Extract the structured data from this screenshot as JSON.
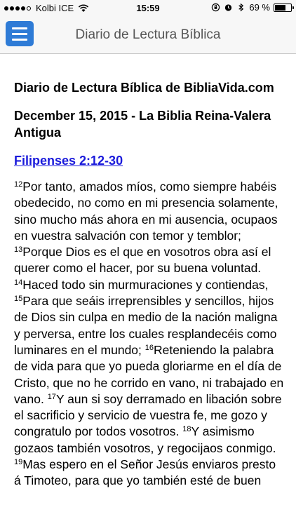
{
  "status_bar": {
    "carrier": "Kolbi ICE",
    "time": "15:59",
    "battery_percent": "69 %",
    "battery_level": 0.69,
    "icons": [
      "wifi-icon",
      "orientation-lock-icon",
      "alarm-icon",
      "bluetooth-icon"
    ]
  },
  "nav": {
    "title": "Diario de Lectura Bíblica",
    "menu_icon": "hamburger-menu-icon",
    "accent_color": "#2e7bd6"
  },
  "content": {
    "site_heading": "Diario de Lectura Bíblica de BibliaVida.com",
    "date_heading": "December 15, 2015 - La Biblia Reina-Valera Antigua",
    "passage_ref": "Filipenses 2:12-30",
    "link_color": "#1a1adb",
    "verses": [
      {
        "num": "12",
        "text": "Por tanto, amados míos, como siempre habéis obedecido, no como en mi presencia solamente, sino mucho más ahora en mi ausencia, ocupaos en vuestra salvación con temor y temblor; "
      },
      {
        "num": "13",
        "text": "Porque Dios es el que en vosotros obra así el querer como el hacer, por su buena voluntad. "
      },
      {
        "num": "14",
        "text": "Haced todo sin murmuraciones y contiendas, "
      },
      {
        "num": "15",
        "text": "Para que seáis irreprensibles y sencillos, hijos de Dios sin culpa en medio de la nación maligna y perversa, entre los cuales resplandecéis como luminares en el mundo; "
      },
      {
        "num": "16",
        "text": "Reteniendo la palabra de vida para que yo pueda gloriarme en el día de Cristo, que no he corrido en vano, ni trabajado en vano. "
      },
      {
        "num": "17",
        "text": "Y aun si soy derramado en libación sobre el sacrificio y servicio de vuestra fe, me gozo y congratulo por todos vosotros. "
      },
      {
        "num": "18",
        "text": "Y asimismo gozaos también vosotros, y regocijaos conmigo. "
      },
      {
        "num": "19",
        "text": "Mas espero en el Señor Jesús enviaros presto á Timoteo, para que yo también esté de buen"
      }
    ]
  }
}
